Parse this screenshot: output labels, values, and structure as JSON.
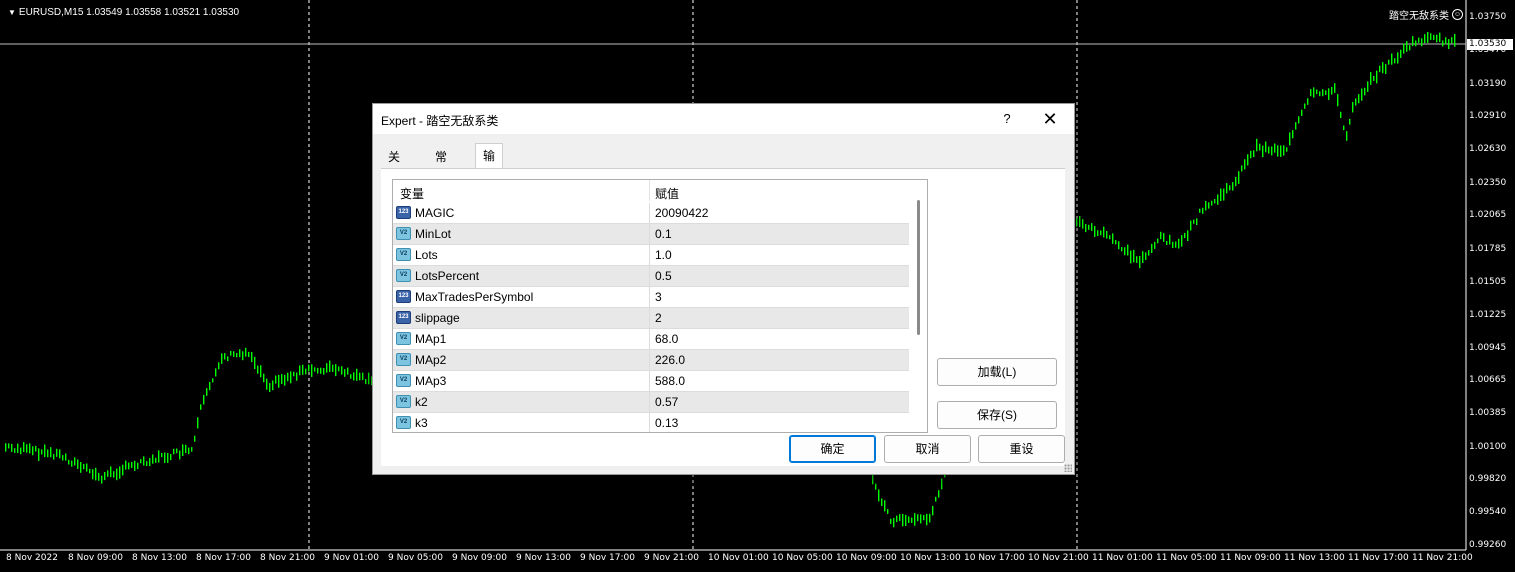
{
  "chart": {
    "symbol_header": "EURUSD,M15  1.03549 1.03558 1.03521 1.03530",
    "ea_name": "踏空无敌系类",
    "smile_glyph": "☺",
    "current_price": "1.03530",
    "price_labels": [
      "1.03750",
      "1.03470",
      "1.03190",
      "1.02910",
      "1.02630",
      "1.02350",
      "1.02065",
      "1.01785",
      "1.01505",
      "1.01225",
      "1.00945",
      "1.00665",
      "1.00385",
      "1.00100",
      "0.99820",
      "0.99540",
      "0.99260"
    ],
    "time_labels": [
      "8 Nov 2022",
      "8 Nov 09:00",
      "8 Nov 13:00",
      "8 Nov 17:00",
      "8 Nov 21:00",
      "9 Nov 01:00",
      "9 Nov 05:00",
      "9 Nov 09:00",
      "9 Nov 13:00",
      "9 Nov 17:00",
      "9 Nov 21:00",
      "10 Nov 01:00",
      "10 Nov 05:00",
      "10 Nov 09:00",
      "10 Nov 13:00",
      "10 Nov 17:00",
      "10 Nov 21:00",
      "11 Nov 01:00",
      "11 Nov 05:00",
      "11 Nov 09:00",
      "11 Nov 13:00",
      "11 Nov 17:00",
      "11 Nov 21:00"
    ],
    "candle_color": "#00ff00",
    "background_color": "#000000"
  },
  "dialog": {
    "title": "Expert - 踏空无敌系类",
    "help_label": "?",
    "close_label": "✕",
    "tabs": [
      {
        "label": "关于",
        "active": false
      },
      {
        "label": "常用",
        "active": false
      },
      {
        "label": "输入参数",
        "active": true
      }
    ],
    "grid": {
      "columns": [
        "变量",
        "赋值"
      ],
      "rows": [
        {
          "name": "MAGIC",
          "value": "20090422",
          "icon": "int-icon",
          "icon_text": "123"
        },
        {
          "name": "MinLot",
          "value": "0.1",
          "icon": "double-icon",
          "icon_text": "V2"
        },
        {
          "name": "Lots",
          "value": "1.0",
          "icon": "double-icon",
          "icon_text": "V2"
        },
        {
          "name": "LotsPercent",
          "value": "0.5",
          "icon": "double-icon",
          "icon_text": "V2"
        },
        {
          "name": "MaxTradesPerSymbol",
          "value": "3",
          "icon": "int-icon",
          "icon_text": "123"
        },
        {
          "name": "slippage",
          "value": "2",
          "icon": "int-icon",
          "icon_text": "123"
        },
        {
          "name": "MAp1",
          "value": "68.0",
          "icon": "double-icon",
          "icon_text": "V2"
        },
        {
          "name": "MAp2",
          "value": "226.0",
          "icon": "double-icon",
          "icon_text": "V2"
        },
        {
          "name": "MAp3",
          "value": "588.0",
          "icon": "double-icon",
          "icon_text": "V2"
        },
        {
          "name": "k2",
          "value": "0.57",
          "icon": "double-icon",
          "icon_text": "V2"
        },
        {
          "name": "k3",
          "value": "0.13",
          "icon": "double-icon",
          "icon_text": "V2"
        }
      ]
    },
    "buttons": {
      "load": "加载(L)",
      "save": "保存(S)",
      "ok": "确定",
      "cancel": "取消",
      "reset": "重设"
    }
  }
}
